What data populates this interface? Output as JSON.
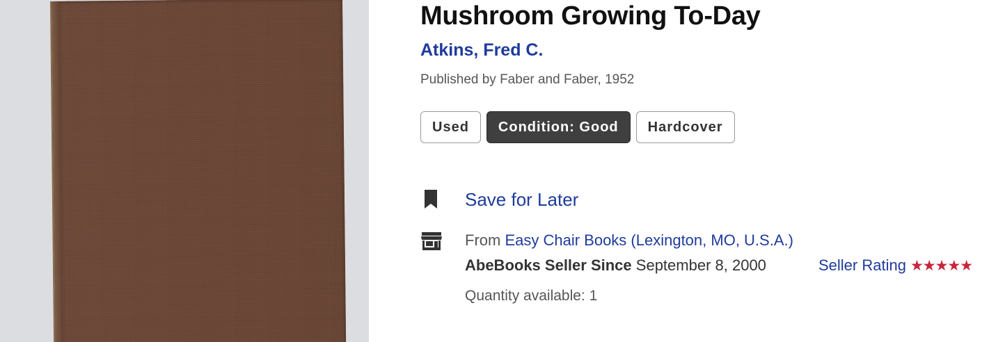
{
  "book": {
    "title": "Mushroom Growing To-Day",
    "author": "Atkins, Fred C.",
    "publisher_line": "Published by Faber and Faber, 1952"
  },
  "badges": [
    {
      "label": "Used"
    },
    {
      "label": "Condition: Good"
    },
    {
      "label": "Hardcover"
    }
  ],
  "save": {
    "label": "Save for Later",
    "icon": "bookmark-icon"
  },
  "seller": {
    "icon": "storefront-icon",
    "from_prefix": "From",
    "name": "Easy Chair Books (Lexington, MO, U.S.A.)",
    "since_label": "AbeBooks Seller Since",
    "since_date": "September 8, 2000",
    "rating_label": "Seller Rating",
    "rating_stars": "★★★★★",
    "rating_value": 5,
    "quantity": "Quantity available: 1"
  },
  "colors": {
    "link": "#1f3b9c",
    "star": "#c8243a",
    "badge_dark": "#3f3f3f"
  }
}
